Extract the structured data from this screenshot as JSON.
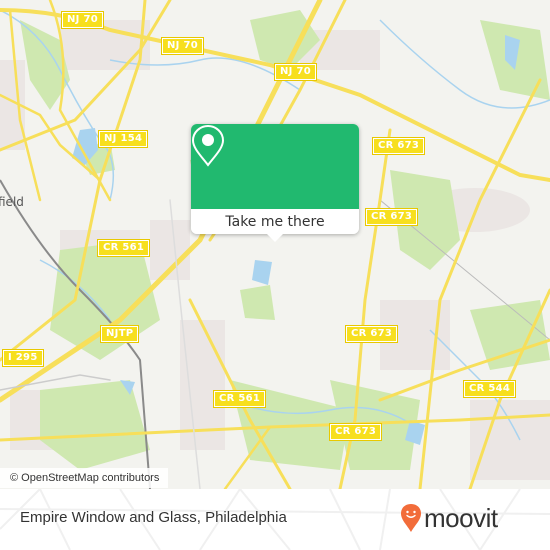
{
  "map": {
    "colors": {
      "background": "#f3f3ef",
      "park": "#cfe8b0",
      "water": "#a9d3ef",
      "road": "#f7df5a",
      "rail": "#8a8a8a",
      "residential": "#ebe6e4"
    },
    "road_labels": [
      {
        "id": "nj70-a",
        "text": "NJ 70"
      },
      {
        "id": "nj70-b",
        "text": "NJ 70"
      },
      {
        "id": "nj70-c",
        "text": "NJ 70"
      },
      {
        "id": "nj154",
        "text": "NJ 154"
      },
      {
        "id": "cr673-a",
        "text": "CR 673"
      },
      {
        "id": "cr673-b",
        "text": "CR 673"
      },
      {
        "id": "cr673-c",
        "text": "CR 673"
      },
      {
        "id": "cr673-d",
        "text": "CR 673"
      },
      {
        "id": "cr561-a",
        "text": "CR 561"
      },
      {
        "id": "cr561-b",
        "text": "CR 561"
      },
      {
        "id": "njtp",
        "text": "NJTP"
      },
      {
        "id": "i295",
        "text": "I 295"
      },
      {
        "id": "cr544",
        "text": "CR 544"
      }
    ],
    "place_labels": [
      {
        "text": "field"
      }
    ],
    "attribution": "© OpenStreetMap contributors"
  },
  "popup": {
    "icon": "map-pin-icon",
    "accent": "#21b96f",
    "button_label": "Take me there"
  },
  "footer": {
    "title": "Empire Window and Glass, Philadelphia",
    "brand": "moovit",
    "brand_color": "#f26c3a"
  }
}
